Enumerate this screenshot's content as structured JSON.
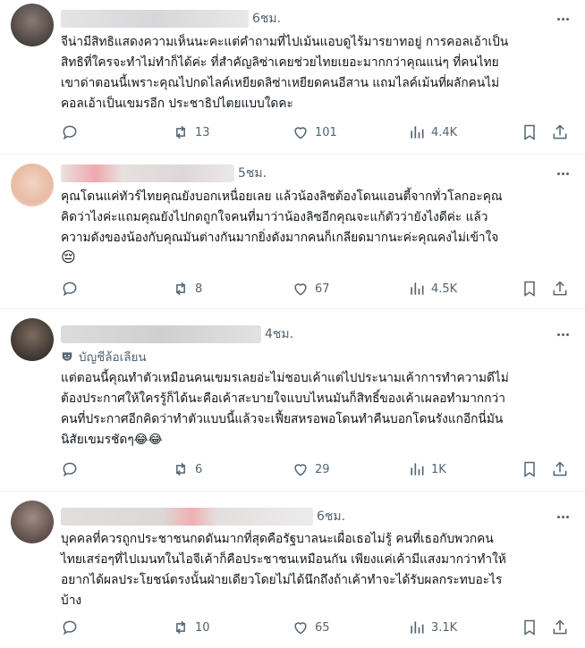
{
  "posts": [
    {
      "time": "6ชม.",
      "text": "จีน่ามีสิทธิแสดงความเห็นนะคะแต่คำถามที่ไปเม้นแอบดูไร้มารยาทอยู่ การคอลเอ้าเป็น\nสิทธิที่ใครจะทำไม่ทำก็ได้ค่ะ ที่สำคัญลิซ่าเคยช่วยไทยเยอะมากกว่าคุณแน่ๆ ที่คนไทย\nเขาด่าตอนนี้เพราะคุณไปกดไลค์เหยียดลิซ่าเหยียดคนอีสาน แถมไลค์เม้นที่ผลักคนไม่\nคอลเอ้าเป็นเขมรอีก ประชาธิปไตยแบบใดคะ",
      "replies": "",
      "reposts": "13",
      "likes": "101",
      "views": "4.4K"
    },
    {
      "time": "5ชม.",
      "text": "คุณโดนแค่ทัวร์ไทยคุณยังบอกเหนื่อยเลย แล้วน้องลิซต้องโดนแอนตี้จากทั่วโลกอะคุณ\nคิดว่าไงค่ะแถมคุณยังไปกดถูกใจคนที่มาว่าน้องลิซอีกคุณจะแก้ตัวว่ายังไงดีค่ะ แล้ว\nความดังของน้องกับคุณมันต่างกันมากยิ่งดังมากคนก็เกลียดมากนะค่ะคุณคงไม่เข้าใจ",
      "emoji": "😔",
      "replies": "",
      "reposts": "8",
      "likes": "67",
      "views": "4.5K"
    },
    {
      "time": "4ชม.",
      "badge": "บัญชีล้อเลียน",
      "text": "แต่ตอนนี้คุณทำตัวเหมือนคนเขมรเลยอ่ะไม่ชอบเค้าแต่ไปประนามเค้าการทำความดีไม่\nต้องประกาศให้ใครรู้ก็ได้นะคือเค้าสะบายใจแบบไหนมันก็สิทธิ์ของเค้าเผลอทำมากกว่า\nคนที่ประกาศอีกคิดว่าทำตัวแบบนี้แล้วจะเฟี้ยสหรอพอโดนทำคืนบอกโดนรังแกอีกนี่มัน\nนิสัยเขมรชัดๆ😂😂",
      "replies": "",
      "reposts": "6",
      "likes": "29",
      "views": "1K"
    },
    {
      "time": "6ชม.",
      "text": "บุคคลที่ควรถูกประชาชนกดดันมากที่สุดคือรัฐบาลนะเผื่อเธอไม่รู้ คนที่เธอกับพวกคน\nไทยเสร่อๆที่ไปเมนทในไอจีเค้าก็คือประชาชนเหมือนกัน เพียงแค่เค้ามีแสงมากว่าทำให้\nอยากได้ผลประโยชน์ตรงนั้นฝ่ายเดียวโดยไม่ได้นึกถึงถ้าเค้าทำจะได้รับผลกระทบอะไร\nบ้าง",
      "replies": "",
      "reposts": "10",
      "likes": "65",
      "views": "3.1K"
    }
  ]
}
